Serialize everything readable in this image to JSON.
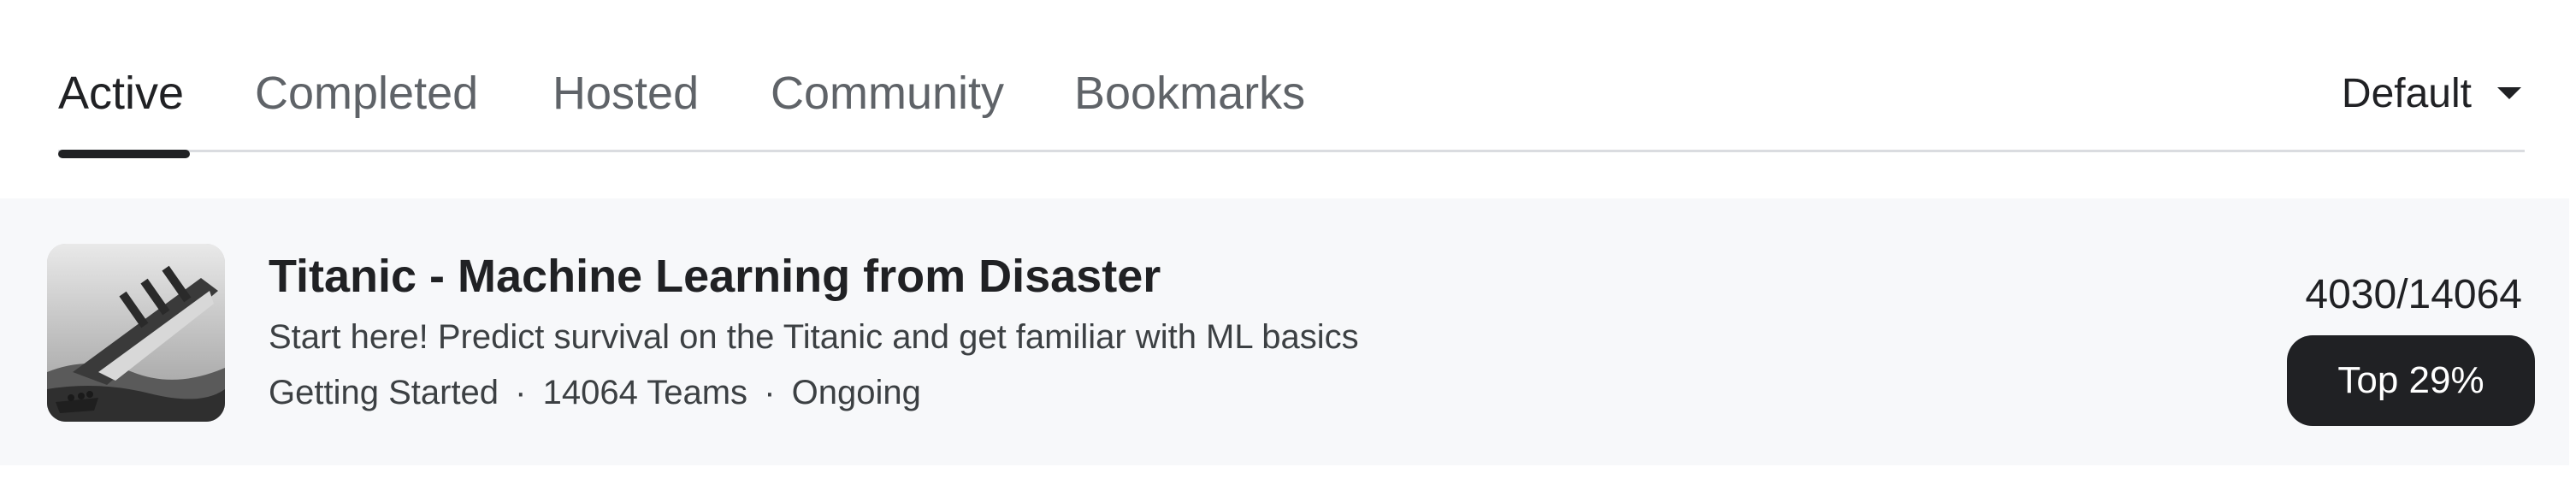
{
  "tabs": [
    {
      "label": "Active",
      "active": true
    },
    {
      "label": "Completed",
      "active": false
    },
    {
      "label": "Hosted",
      "active": false
    },
    {
      "label": "Community",
      "active": false
    },
    {
      "label": "Bookmarks",
      "active": false
    }
  ],
  "sort": {
    "value": "Default",
    "icon": "caret-down-icon"
  },
  "competition": {
    "title": "Titanic - Machine Learning from Disaster",
    "description": "Start here! Predict survival on the Titanic and get familiar with ML basics",
    "category": "Getting Started",
    "teams": "14064 Teams",
    "status": "Ongoing",
    "separator": "·",
    "rank": "4030/14064",
    "percentile_badge": "Top 29%",
    "thumbnail_icon": "titanic-sinking-image"
  },
  "colors": {
    "active_tab": "#202124",
    "inactive_tab": "#5f6368",
    "row_background": "#f7f8fa",
    "badge_background": "#202124",
    "badge_text": "#ffffff"
  }
}
